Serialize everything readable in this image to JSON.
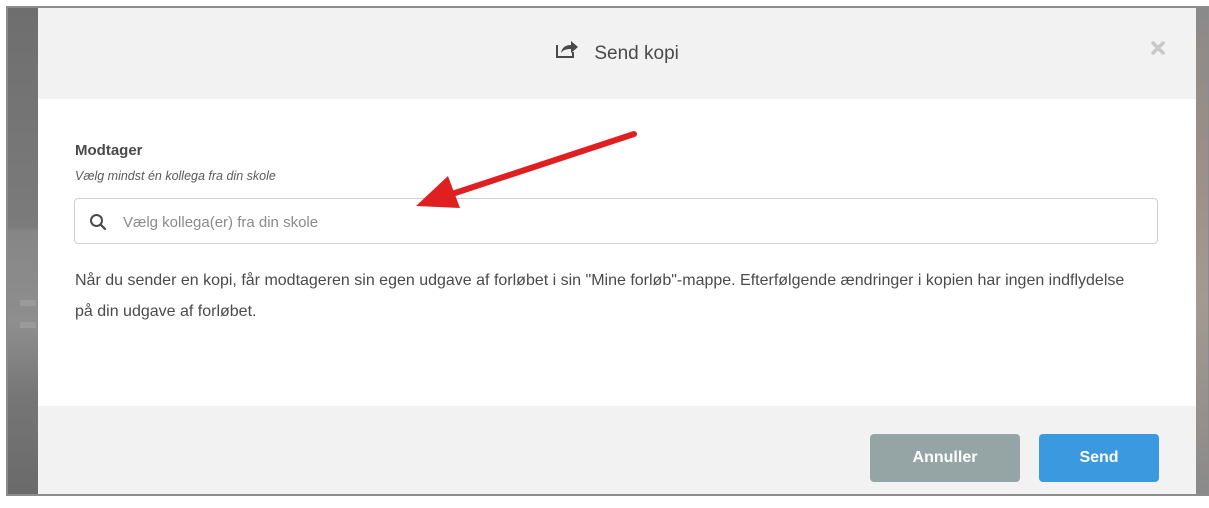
{
  "dialog": {
    "title": "Send kopi",
    "icon": "share-icon",
    "close_icon": "close-icon"
  },
  "recipient": {
    "label": "Modtager",
    "help": "Vælg mindst én kollega fra din skole",
    "search_placeholder": "Vælg kollega(er) fra din skole",
    "search_value": ""
  },
  "info_text": "Når du sender en kopi, får modtageren sin egen udgave af forløbet i sin \"Mine forløb\"-mappe. Efterfølgende ændringer i kopien har ingen indflydelse på din udgave af forløbet.",
  "buttons": {
    "cancel_label": "Annuller",
    "send_label": "Send"
  },
  "colors": {
    "cancel_button": "#95a5a6",
    "send_button": "#3b99e0",
    "annotation_arrow": "#e02020"
  }
}
